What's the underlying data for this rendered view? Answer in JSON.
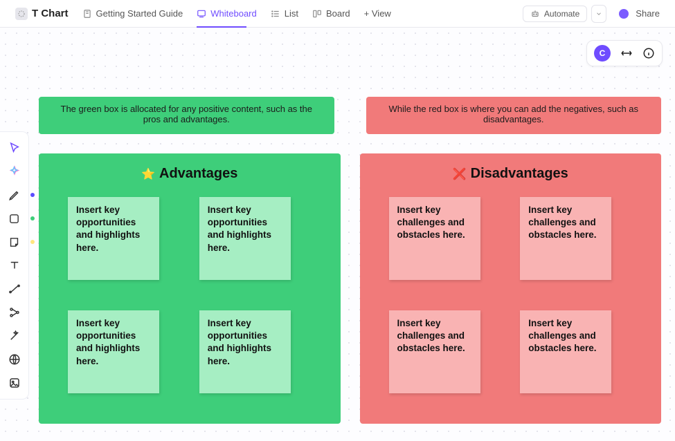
{
  "header": {
    "title": "T Chart",
    "tabs": [
      {
        "id": "guide",
        "label": "Getting Started Guide"
      },
      {
        "id": "whiteboard",
        "label": "Whiteboard"
      },
      {
        "id": "list",
        "label": "List"
      },
      {
        "id": "board",
        "label": "Board"
      },
      {
        "id": "addview",
        "label": "+ View"
      }
    ],
    "automate_label": "Automate",
    "share_label": "Share"
  },
  "float_panel": {
    "avatar_letter": "C"
  },
  "tchart": {
    "info_green": "The green box is allocated for any positive content, such as the pros and advantages.",
    "info_red": "While the red box is where you can add the negatives, such as disadvantages.",
    "advantages": {
      "icon": "⭐",
      "title": "Advantages",
      "notes": [
        "Insert key opportunities and highlights here.",
        "Insert key opportunities and highlights here.",
        "Insert key opportunities and highlights here.",
        "Insert key opportunities and highlights here."
      ]
    },
    "disadvantages": {
      "icon": "❌",
      "title": "Disadvantages",
      "notes": [
        "Insert key challenges and obstacles here.",
        "Insert key challenges and obstacles here.",
        "Insert key challenges and obstacles here.",
        "Insert key challenges and obstacles here."
      ]
    }
  },
  "toolbox": {
    "pen_color": "#5b4cff",
    "shape_color": "#3ece7a",
    "sticky_color": "#ffe680"
  }
}
